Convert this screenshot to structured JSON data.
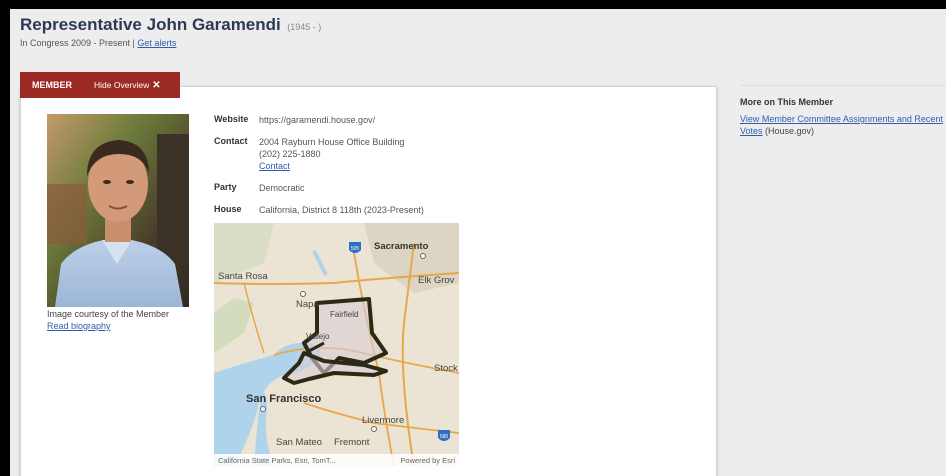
{
  "member": {
    "name": "Representative John Garamendi",
    "years": "(1945 - )",
    "congress_text": "In Congress 2009 - Present |",
    "alerts_link": "Get alerts"
  },
  "tabs": {
    "member_label": "MEMBER",
    "hide_label": "Hide Overview",
    "hide_icon": "✕"
  },
  "overview": {
    "photo_caption": "Image courtesy of the Member",
    "read_bio": "Read biography",
    "website_label": "Website",
    "website_value": "https://garamendi.house.gov/",
    "contact_label": "Contact",
    "contact_address": "2004 Rayburn House Office Building",
    "contact_phone": "(202) 225-1880",
    "contact_link": "Contact",
    "party_label": "Party",
    "party_value": "Democratic",
    "house_label": "House",
    "house_value": "California, District 8 118th (2023-Present)"
  },
  "map": {
    "cities": {
      "sacramento": "Sacramento",
      "santa_rosa": "Santa Rosa",
      "elk_grove": "Elk Grov",
      "napa": "Napa",
      "fairfield": "Fairfield",
      "vallejo": "Vallejo",
      "stockton": "Stock",
      "san_francisco": "San Francisco",
      "livermore": "Livermore",
      "san_mateo": "San Mateo",
      "fremont": "Fremont"
    },
    "shields": {
      "i505": "505",
      "i580": "580"
    },
    "attribution": "California State Parks, Esri, TomT...",
    "powered": "Powered by Esri"
  },
  "sidebar": {
    "title": "More on This Member",
    "link": "View Member Committee Assignments and Recent Votes",
    "suffix": " (House.gov)"
  }
}
